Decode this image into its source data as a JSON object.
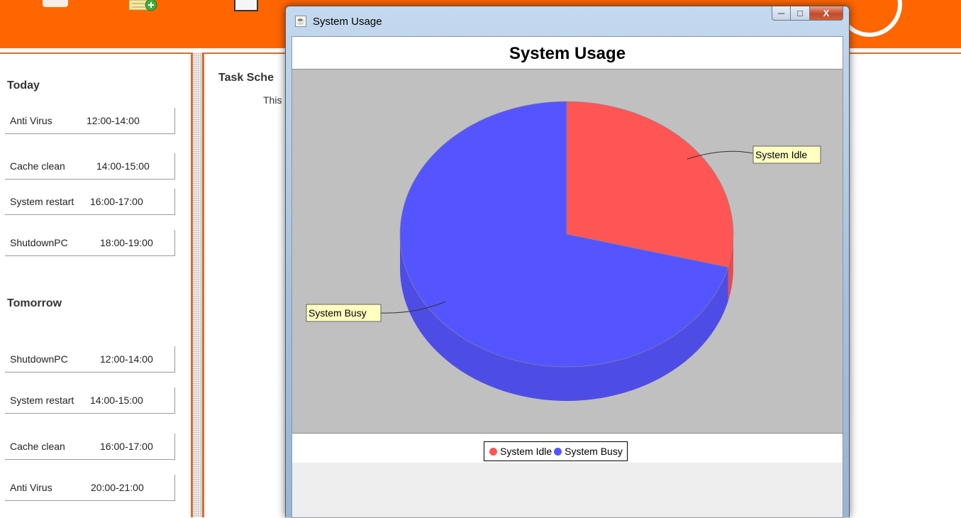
{
  "colors": {
    "toolbar": "#ff6600",
    "panel_border": "#e26a2c",
    "plot_background": "#c0c0c0",
    "idle": "#ff5555",
    "busy": "#5555ff"
  },
  "toolbar": {
    "icons": [
      "home-icon",
      "add-schedule-icon",
      "search-icon"
    ]
  },
  "schedule": {
    "today": {
      "title": "Today",
      "items": [
        {
          "name": "Anti Virus",
          "time": "12:00-14:00"
        },
        {
          "name": "Cache clean",
          "time": "14:00-15:00"
        },
        {
          "name": "System restart",
          "time": "16:00-17:00"
        },
        {
          "name": "ShutdownPC",
          "time": "18:00-19:00"
        }
      ]
    },
    "tomorrow": {
      "title": "Tomorrow",
      "items": [
        {
          "name": "ShutdownPC",
          "time": "12:00-14:00"
        },
        {
          "name": "System restart",
          "time": "14:00-15:00"
        },
        {
          "name": "Cache clean",
          "time": "16:00-17:00"
        },
        {
          "name": "Anti Virus",
          "time": "20:00-21:00"
        }
      ]
    }
  },
  "main": {
    "heading": "Task Sche",
    "subtext": "This"
  },
  "window": {
    "title": "System Usage",
    "icon": "java-icon",
    "controls": {
      "minimize": "minimize-icon",
      "maximize": "maximize-icon",
      "close": "close-icon"
    },
    "close_label": "X"
  },
  "chart_data": {
    "type": "pie",
    "title": "System Usage",
    "slices": [
      {
        "label": "System Idle",
        "value": 29,
        "color": "#ff5555"
      },
      {
        "label": "System Busy",
        "value": 71,
        "color": "#5555ff"
      }
    ],
    "legend": [
      "System Idle",
      "System Busy"
    ],
    "legend_position": "bottom",
    "style": "3d"
  }
}
